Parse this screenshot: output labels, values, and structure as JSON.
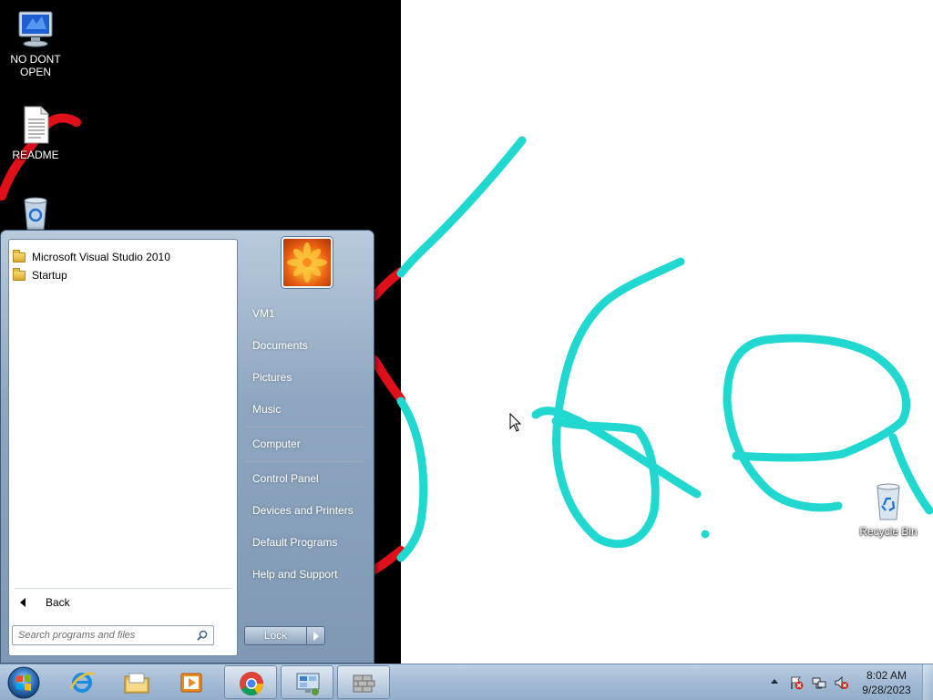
{
  "desktop": {
    "icons": [
      {
        "label": "NO DONT\nOPEN",
        "icon": "computer-icon"
      },
      {
        "label": "README",
        "icon": "text-file-icon"
      },
      {
        "label": "",
        "icon": "recycle-bin-icon"
      },
      {
        "label": "Recycle Bin",
        "icon": "recycle-bin-icon"
      }
    ],
    "background_color": "#000000",
    "paint_canvas_color": "#ffffff",
    "stroke_colors": {
      "cyan": "#20d8d0",
      "red": "#e0101a"
    }
  },
  "start_menu": {
    "programs": [
      {
        "label": "Microsoft Visual Studio 2010",
        "icon": "folder-icon"
      },
      {
        "label": "Startup",
        "icon": "folder-icon"
      }
    ],
    "back_label": "Back",
    "search": {
      "placeholder": "Search programs and files",
      "value": ""
    },
    "right_items": [
      {
        "label": "VM1"
      },
      {
        "label": "Documents"
      },
      {
        "label": "Pictures"
      },
      {
        "label": "Music"
      },
      {
        "label": "Computer"
      },
      {
        "label": "Control Panel"
      },
      {
        "label": "Devices and Printers"
      },
      {
        "label": "Default Programs"
      },
      {
        "label": "Help and Support"
      }
    ],
    "lock_label": "Lock"
  },
  "taskbar": {
    "pinned": [
      {
        "name": "internet-explorer-icon"
      },
      {
        "name": "windows-explorer-icon"
      },
      {
        "name": "media-player-icon"
      },
      {
        "name": "chrome-icon"
      },
      {
        "name": "remote-desktop-icon"
      },
      {
        "name": "firewall-icon"
      }
    ],
    "tray_icons": [
      "action-center-flag-icon",
      "network-icon",
      "volume-muted-icon"
    ],
    "clock": {
      "time": "8:02 AM",
      "date": "9/28/2023"
    }
  }
}
